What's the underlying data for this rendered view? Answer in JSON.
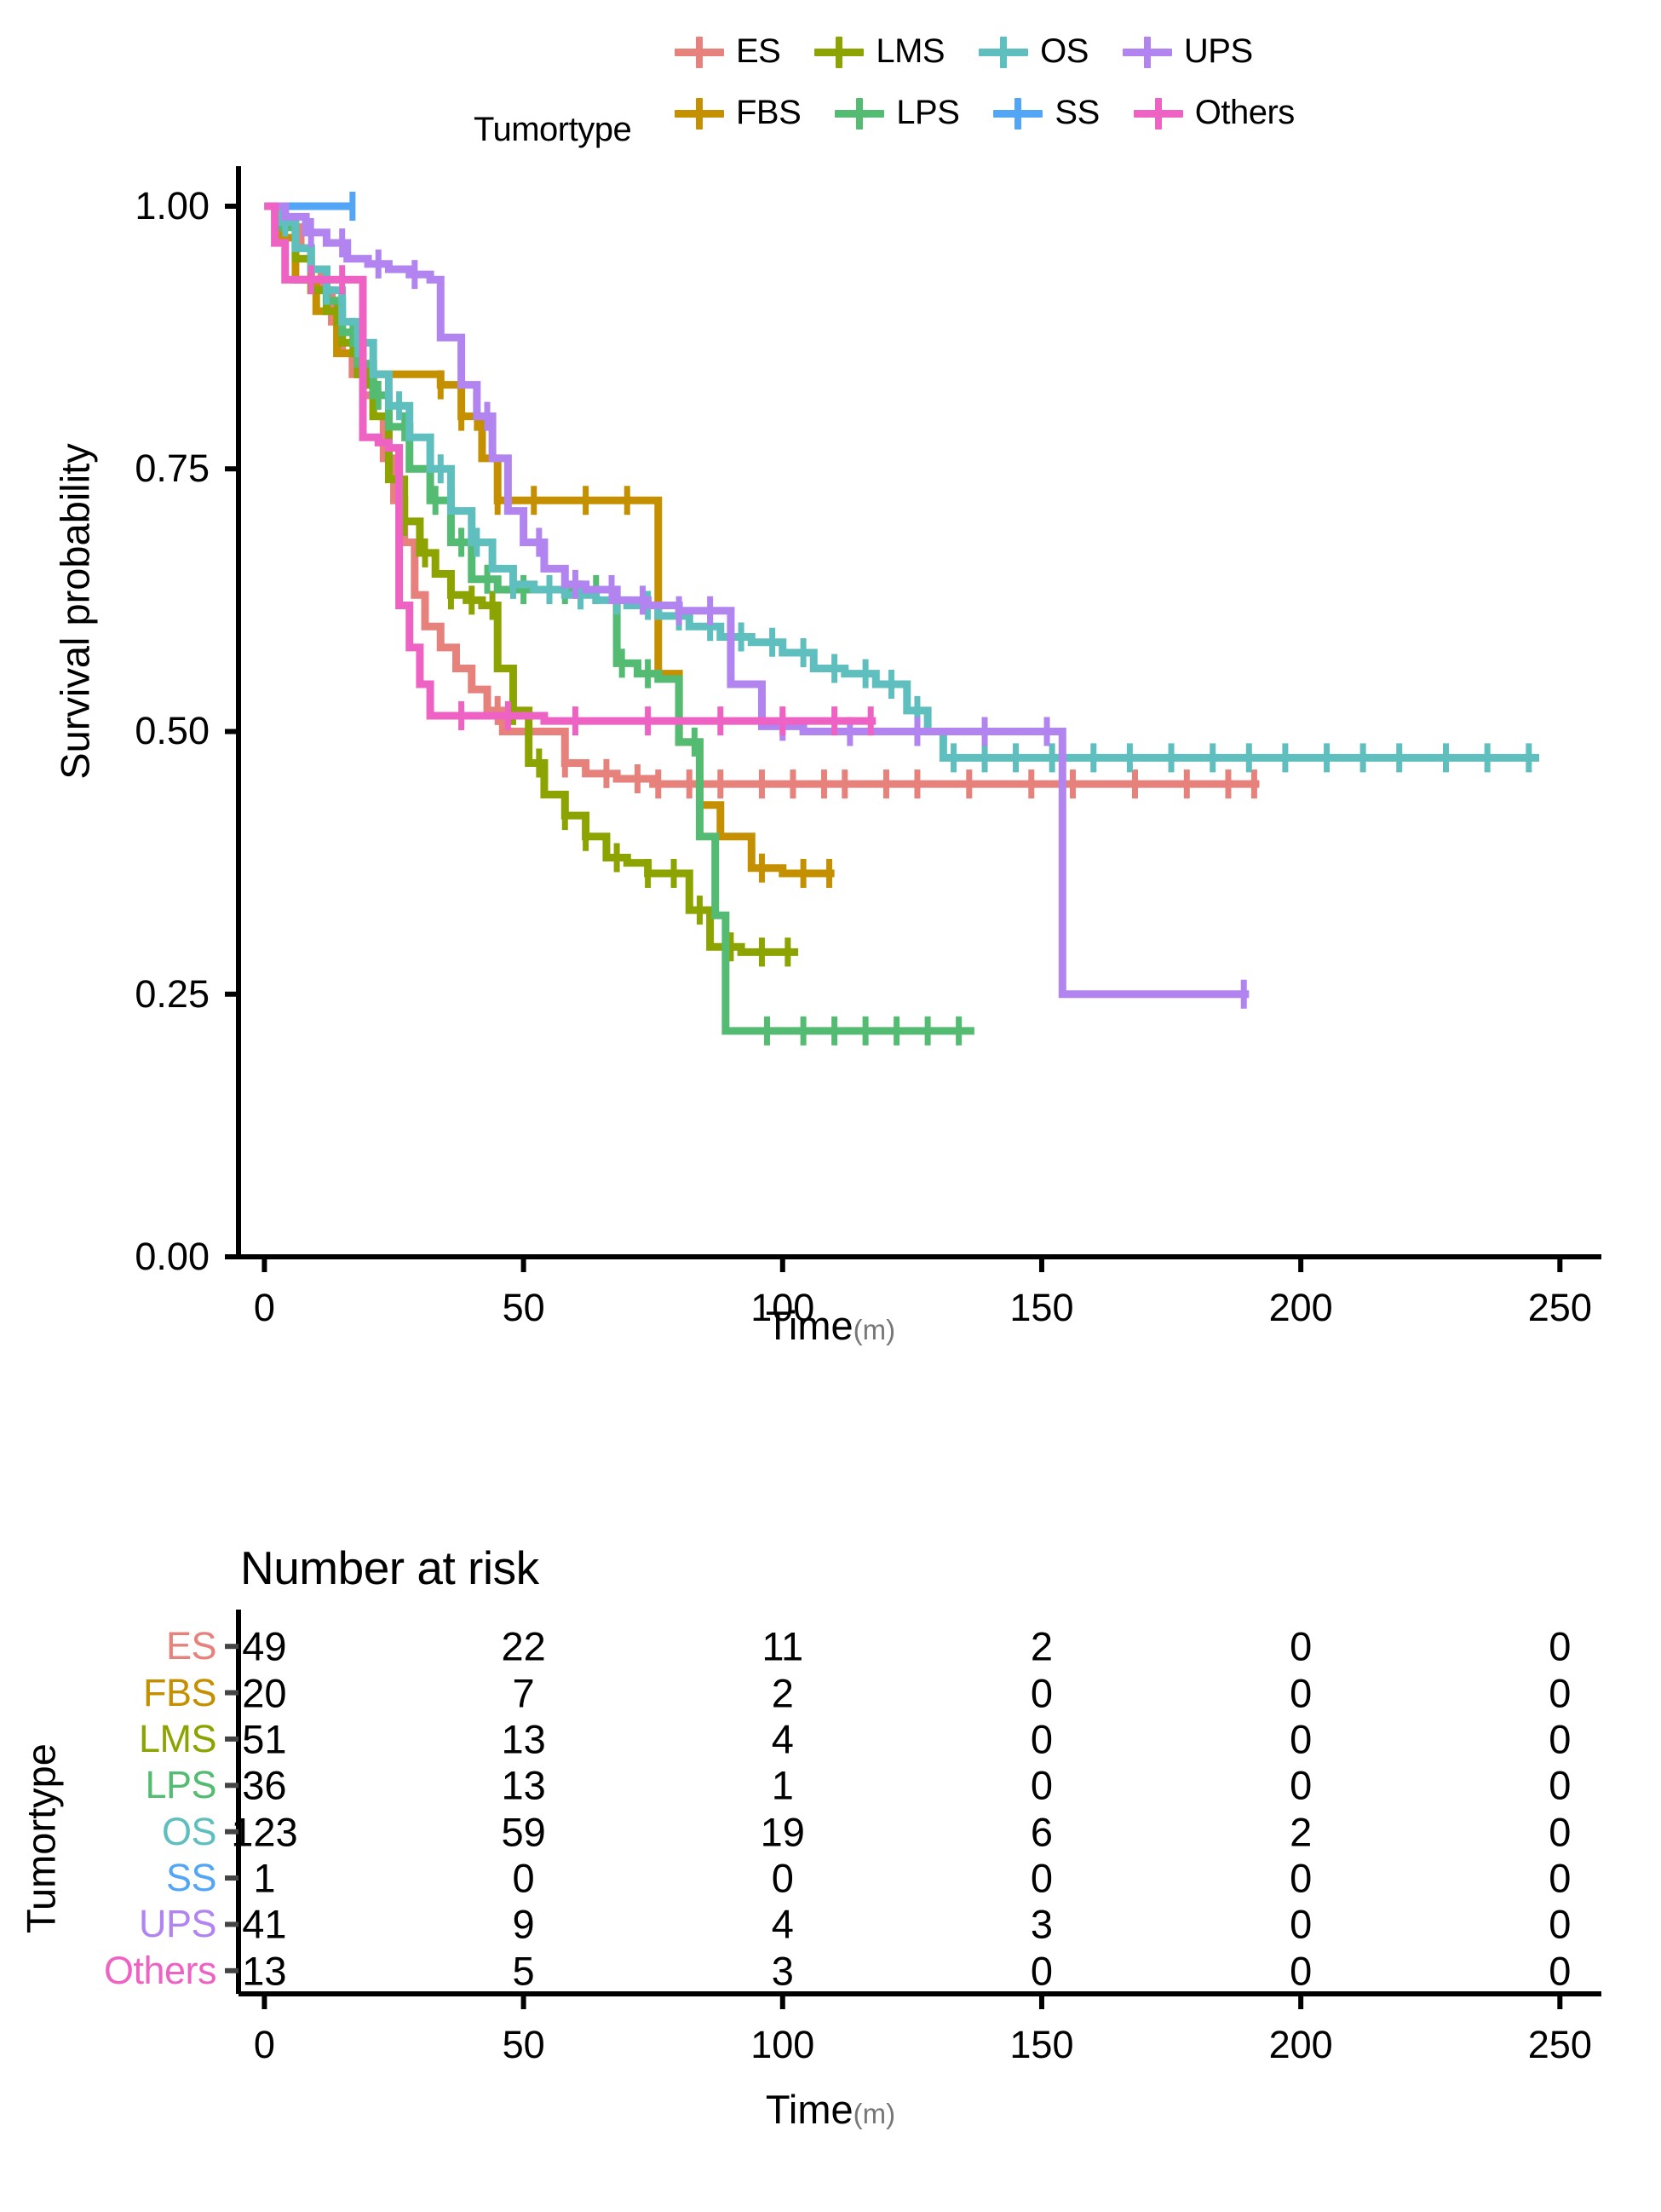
{
  "legend": {
    "title": "Tumortype",
    "row1": [
      {
        "label": "ES",
        "color": "#E7817C"
      },
      {
        "label": "LMS",
        "color": "#8CA300"
      },
      {
        "label": "OS",
        "color": "#5FBFBF"
      },
      {
        "label": "UPS",
        "color": "#B184F0"
      }
    ],
    "row2": [
      {
        "label": "FBS",
        "color": "#C59000"
      },
      {
        "label": "LPS",
        "color": "#54BB72"
      },
      {
        "label": "SS",
        "color": "#53A6F5"
      },
      {
        "label": "Others",
        "color": "#EE62C4"
      }
    ]
  },
  "risk_table": {
    "title": "Number at risk",
    "ylabel": "Tumortype",
    "xlabel": "Time",
    "xunit": "(m)",
    "x_ticks": [
      0,
      50,
      100,
      150,
      200,
      250
    ],
    "rows": [
      {
        "label": "ES",
        "color": "#E7817C",
        "values": [
          49,
          22,
          11,
          2,
          0,
          0
        ]
      },
      {
        "label": "FBS",
        "color": "#C59000",
        "values": [
          20,
          7,
          2,
          0,
          0,
          0
        ]
      },
      {
        "label": "LMS",
        "color": "#8CA300",
        "values": [
          51,
          13,
          4,
          0,
          0,
          0
        ]
      },
      {
        "label": "LPS",
        "color": "#54BB72",
        "values": [
          36,
          13,
          1,
          0,
          0,
          0
        ]
      },
      {
        "label": "OS",
        "color": "#5FBFBF",
        "values": [
          123,
          59,
          19,
          6,
          2,
          0
        ]
      },
      {
        "label": "SS",
        "color": "#53A6F5",
        "values": [
          1,
          0,
          0,
          0,
          0,
          0
        ]
      },
      {
        "label": "UPS",
        "color": "#B184F0",
        "values": [
          41,
          9,
          4,
          3,
          0,
          0
        ]
      },
      {
        "label": "Others",
        "color": "#EE62C4",
        "values": [
          13,
          5,
          3,
          0,
          0,
          0
        ]
      }
    ]
  },
  "chart_data": {
    "type": "line",
    "title": "",
    "xlabel": "Time",
    "xunit": "(m)",
    "ylabel": "Survival probability",
    "xlim": [
      -5,
      258
    ],
    "ylim": [
      0.0,
      1.03
    ],
    "x_ticks": [
      0,
      50,
      100,
      150,
      200,
      250
    ],
    "y_ticks": [
      0.0,
      0.25,
      0.5,
      0.75,
      1.0
    ],
    "y_tick_labels": [
      "0.00",
      "0.25",
      "0.50",
      "0.75",
      "1.00"
    ],
    "grid": false,
    "legend_position": "top",
    "legend_title": "Tumortype",
    "censor_marker": "plus",
    "series": [
      {
        "name": "ES",
        "color": "#E7817C",
        "points": [
          [
            0,
            1.0
          ],
          [
            4,
            0.98
          ],
          [
            7,
            0.96
          ],
          [
            9,
            0.94
          ],
          [
            11,
            0.92
          ],
          [
            13,
            0.89
          ],
          [
            15,
            0.86
          ],
          [
            17,
            0.84
          ],
          [
            19,
            0.82
          ],
          [
            21,
            0.8
          ],
          [
            23,
            0.76
          ],
          [
            25,
            0.72
          ],
          [
            27,
            0.68
          ],
          [
            29,
            0.63
          ],
          [
            31,
            0.6
          ],
          [
            34,
            0.58
          ],
          [
            37,
            0.56
          ],
          [
            40,
            0.54
          ],
          [
            43,
            0.52
          ],
          [
            46,
            0.5
          ],
          [
            50,
            0.5
          ],
          [
            55,
            0.5
          ],
          [
            58,
            0.47
          ],
          [
            62,
            0.46
          ],
          [
            68,
            0.455
          ],
          [
            75,
            0.45
          ],
          [
            85,
            0.45
          ],
          [
            100,
            0.45
          ],
          [
            120,
            0.45
          ],
          [
            145,
            0.45
          ],
          [
            170,
            0.45
          ],
          [
            192,
            0.45
          ]
        ],
        "censor_x": [
          45,
          58,
          66,
          72,
          76,
          82,
          88,
          96,
          102,
          108,
          112,
          120,
          126,
          136,
          148,
          156,
          168,
          178,
          186,
          191
        ]
      },
      {
        "name": "FBS",
        "color": "#C59000",
        "points": [
          [
            0,
            1.0
          ],
          [
            3,
            0.97
          ],
          [
            6,
            0.93
          ],
          [
            10,
            0.9
          ],
          [
            14,
            0.86
          ],
          [
            18,
            0.84
          ],
          [
            22,
            0.84
          ],
          [
            26,
            0.84
          ],
          [
            30,
            0.84
          ],
          [
            34,
            0.83
          ],
          [
            38,
            0.8
          ],
          [
            42,
            0.76
          ],
          [
            45,
            0.72
          ],
          [
            52,
            0.72
          ],
          [
            60,
            0.72
          ],
          [
            70,
            0.72
          ],
          [
            76,
            0.72
          ],
          [
            76,
            0.555
          ],
          [
            80,
            0.49
          ],
          [
            84,
            0.43
          ],
          [
            88,
            0.4
          ],
          [
            94,
            0.37
          ],
          [
            100,
            0.365
          ],
          [
            110,
            0.365
          ]
        ],
        "censor_x": [
          34,
          38,
          41,
          45,
          52,
          62,
          70,
          96,
          104,
          109
        ]
      },
      {
        "name": "LMS",
        "color": "#8CA300",
        "points": [
          [
            0,
            1.0
          ],
          [
            3,
            0.98
          ],
          [
            6,
            0.95
          ],
          [
            9,
            0.92
          ],
          [
            12,
            0.9
          ],
          [
            15,
            0.87
          ],
          [
            18,
            0.84
          ],
          [
            21,
            0.8
          ],
          [
            24,
            0.74
          ],
          [
            27,
            0.7
          ],
          [
            30,
            0.67
          ],
          [
            33,
            0.65
          ],
          [
            36,
            0.63
          ],
          [
            39,
            0.625
          ],
          [
            42,
            0.62
          ],
          [
            45,
            0.56
          ],
          [
            48,
            0.52
          ],
          [
            51,
            0.47
          ],
          [
            54,
            0.44
          ],
          [
            58,
            0.42
          ],
          [
            62,
            0.4
          ],
          [
            66,
            0.38
          ],
          [
            70,
            0.375
          ],
          [
            74,
            0.365
          ],
          [
            78,
            0.365
          ],
          [
            82,
            0.33
          ],
          [
            86,
            0.295
          ],
          [
            92,
            0.29
          ],
          [
            100,
            0.29
          ],
          [
            103,
            0.29
          ]
        ],
        "censor_x": [
          14,
          17,
          20,
          27,
          31,
          36,
          40,
          44,
          48,
          53,
          58,
          62,
          68,
          74,
          79,
          84,
          90,
          96,
          101
        ]
      },
      {
        "name": "LPS",
        "color": "#54BB72",
        "points": [
          [
            0,
            1.0
          ],
          [
            3,
            0.98
          ],
          [
            6,
            0.96
          ],
          [
            9,
            0.94
          ],
          [
            12,
            0.91
          ],
          [
            15,
            0.88
          ],
          [
            18,
            0.85
          ],
          [
            21,
            0.82
          ],
          [
            24,
            0.79
          ],
          [
            28,
            0.75
          ],
          [
            32,
            0.72
          ],
          [
            36,
            0.68
          ],
          [
            40,
            0.645
          ],
          [
            45,
            0.635
          ],
          [
            50,
            0.635
          ],
          [
            56,
            0.635
          ],
          [
            62,
            0.635
          ],
          [
            66,
            0.635
          ],
          [
            68,
            0.565
          ],
          [
            72,
            0.555
          ],
          [
            76,
            0.55
          ],
          [
            80,
            0.49
          ],
          [
            84,
            0.4
          ],
          [
            87,
            0.325
          ],
          [
            89,
            0.215
          ],
          [
            95,
            0.215
          ],
          [
            105,
            0.215
          ],
          [
            115,
            0.215
          ],
          [
            125,
            0.215
          ],
          [
            137,
            0.215
          ]
        ],
        "censor_x": [
          17,
          22,
          27,
          33,
          38,
          43,
          50,
          58,
          64,
          69,
          74,
          83,
          97,
          104,
          110,
          116,
          122,
          128,
          134
        ]
      },
      {
        "name": "OS",
        "color": "#5FBFBF",
        "points": [
          [
            0,
            1.0
          ],
          [
            3,
            0.985
          ],
          [
            6,
            0.96
          ],
          [
            9,
            0.94
          ],
          [
            12,
            0.92
          ],
          [
            15,
            0.89
          ],
          [
            18,
            0.87
          ],
          [
            21,
            0.84
          ],
          [
            24,
            0.81
          ],
          [
            28,
            0.78
          ],
          [
            32,
            0.75
          ],
          [
            36,
            0.71
          ],
          [
            40,
            0.68
          ],
          [
            44,
            0.655
          ],
          [
            48,
            0.64
          ],
          [
            52,
            0.635
          ],
          [
            58,
            0.63
          ],
          [
            64,
            0.625
          ],
          [
            70,
            0.62
          ],
          [
            76,
            0.61
          ],
          [
            82,
            0.6
          ],
          [
            88,
            0.59
          ],
          [
            94,
            0.585
          ],
          [
            100,
            0.575
          ],
          [
            106,
            0.56
          ],
          [
            112,
            0.555
          ],
          [
            118,
            0.545
          ],
          [
            124,
            0.52
          ],
          [
            128,
            0.5
          ],
          [
            131,
            0.475
          ],
          [
            140,
            0.475
          ],
          [
            155,
            0.475
          ],
          [
            170,
            0.475
          ],
          [
            185,
            0.475
          ],
          [
            200,
            0.475
          ],
          [
            220,
            0.475
          ],
          [
            235,
            0.475
          ],
          [
            246,
            0.475
          ]
        ],
        "censor_x": [
          4,
          12,
          18,
          26,
          34,
          41,
          48,
          55,
          61,
          68,
          74,
          80,
          86,
          92,
          98,
          104,
          110,
          116,
          121,
          126,
          133,
          139,
          145,
          152,
          160,
          167,
          175,
          183,
          190,
          197,
          205,
          212,
          219,
          228,
          236,
          244
        ]
      },
      {
        "name": "SS",
        "color": "#53A6F5",
        "points": [
          [
            0,
            1.0
          ],
          [
            5,
            1.0
          ],
          [
            10,
            1.0
          ],
          [
            15,
            1.0
          ],
          [
            17,
            1.0
          ]
        ],
        "censor_x": [
          17
        ]
      },
      {
        "name": "UPS",
        "color": "#B184F0",
        "points": [
          [
            0,
            1.0
          ],
          [
            4,
            0.99
          ],
          [
            8,
            0.975
          ],
          [
            12,
            0.965
          ],
          [
            16,
            0.95
          ],
          [
            20,
            0.945
          ],
          [
            24,
            0.94
          ],
          [
            28,
            0.935
          ],
          [
            32,
            0.93
          ],
          [
            34,
            0.875
          ],
          [
            38,
            0.83
          ],
          [
            41,
            0.8
          ],
          [
            44,
            0.76
          ],
          [
            47,
            0.71
          ],
          [
            50,
            0.68
          ],
          [
            54,
            0.655
          ],
          [
            58,
            0.64
          ],
          [
            62,
            0.635
          ],
          [
            68,
            0.625
          ],
          [
            74,
            0.62
          ],
          [
            80,
            0.615
          ],
          [
            86,
            0.615
          ],
          [
            90,
            0.545
          ],
          [
            96,
            0.505
          ],
          [
            104,
            0.5
          ],
          [
            115,
            0.5
          ],
          [
            128,
            0.5
          ],
          [
            140,
            0.5
          ],
          [
            154,
            0.5
          ],
          [
            154,
            0.25
          ],
          [
            165,
            0.25
          ],
          [
            178,
            0.25
          ],
          [
            190,
            0.25
          ]
        ],
        "censor_x": [
          9,
          15,
          22,
          29,
          43,
          53,
          60,
          67,
          73,
          80,
          86,
          100,
          113,
          126,
          139,
          151,
          189
        ]
      },
      {
        "name": "Others",
        "color": "#EE62C4",
        "points": [
          [
            0,
            1.0
          ],
          [
            2,
            0.965
          ],
          [
            4,
            0.93
          ],
          [
            10,
            0.93
          ],
          [
            16,
            0.93
          ],
          [
            19,
            0.78
          ],
          [
            22,
            0.775
          ],
          [
            24,
            0.77
          ],
          [
            26,
            0.62
          ],
          [
            28,
            0.58
          ],
          [
            30,
            0.545
          ],
          [
            32,
            0.515
          ],
          [
            40,
            0.515
          ],
          [
            48,
            0.515
          ],
          [
            54,
            0.51
          ],
          [
            62,
            0.51
          ],
          [
            70,
            0.51
          ],
          [
            78,
            0.51
          ],
          [
            86,
            0.51
          ],
          [
            94,
            0.51
          ],
          [
            102,
            0.51
          ],
          [
            110,
            0.51
          ],
          [
            118,
            0.51
          ]
        ],
        "censor_x": [
          9,
          15,
          38,
          47,
          60,
          74,
          88,
          100,
          110,
          117
        ]
      }
    ]
  }
}
